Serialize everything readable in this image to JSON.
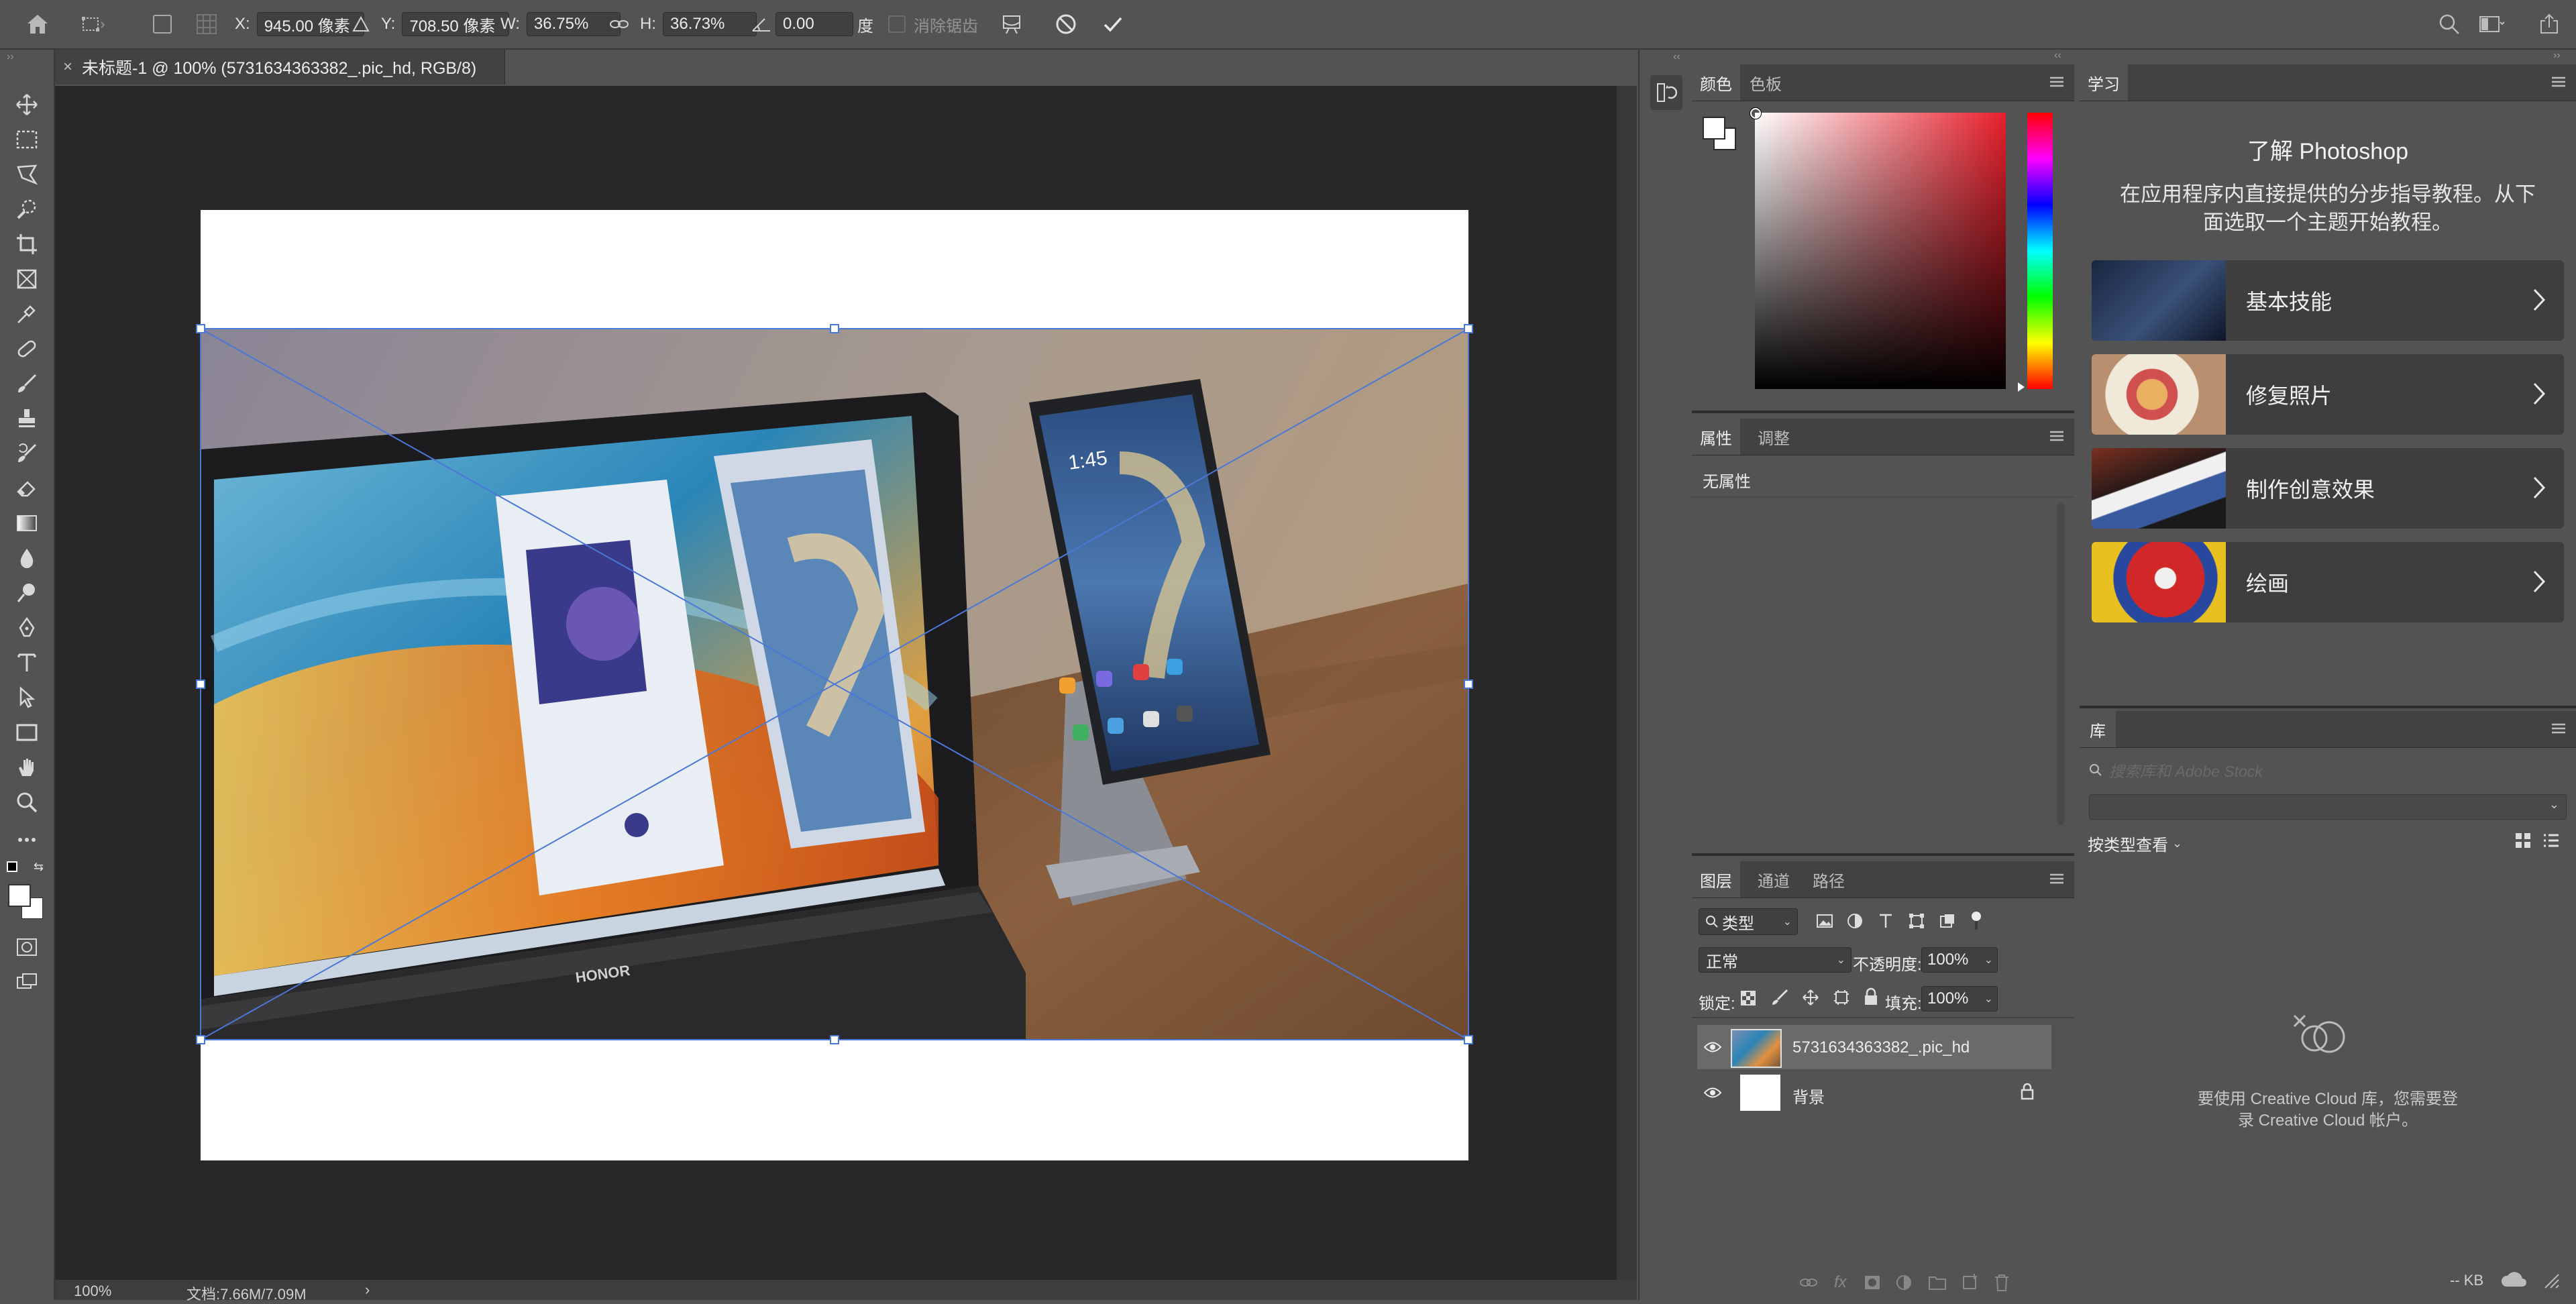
{
  "optionsbar": {
    "x_label": "X:",
    "x_value": "945.00 像素",
    "y_label": "Y:",
    "y_value": "708.50 像素",
    "w_label": "W:",
    "w_value": "36.75%",
    "h_label": "H:",
    "h_value": "36.73%",
    "angle_value": "0.00",
    "angle_unit": "度",
    "antialias_label": "消除锯齿"
  },
  "document": {
    "tab_title": "未标题-1 @ 100% (5731634363382_.pic_hd, RGB/8)",
    "close_glyph": "×"
  },
  "statusbar": {
    "zoom": "100%",
    "doc_info": "文档:7.66M/7.09M",
    "arrow": "›"
  },
  "color_panel": {
    "tabs": [
      "颜色",
      "色板"
    ]
  },
  "properties_panel": {
    "tabs": [
      "属性",
      "调整"
    ],
    "empty_text": "无属性"
  },
  "layers_panel": {
    "tabs": [
      "图层",
      "通道",
      "路径"
    ],
    "filter_kind": "类型",
    "blend_mode": "正常",
    "opacity_label": "不透明度:",
    "opacity_value": "100%",
    "lock_label": "锁定:",
    "fill_label": "填充:",
    "fill_value": "100%",
    "layers": [
      {
        "name": "5731634363382_.pic_hd",
        "selected": true
      },
      {
        "name": "背景",
        "selected": false,
        "locked": true
      }
    ]
  },
  "learn_panel": {
    "tab": "学习",
    "heading": "了解 Photoshop",
    "description_line1": "在应用程序内直接提供的分步指导教程。从下",
    "description_line2": "面选取一个主题开始教程。",
    "topics": [
      {
        "title": "基本技能"
      },
      {
        "title": "修复照片"
      },
      {
        "title": "制作创意效果"
      },
      {
        "title": "绘画"
      }
    ]
  },
  "libraries_panel": {
    "tab": "库",
    "search_placeholder": "搜索库和 Adobe Stock",
    "view_by": "按类型查看",
    "message_line1": "要使用 Creative Cloud 库，您需要登",
    "message_line2": "录 Creative Cloud 帐户。",
    "size": "-- KB"
  },
  "colors": {
    "app_bg": "#535353",
    "canvas_bg": "#282828",
    "panel_header": "#424242",
    "accent_transform": "#4a78d6"
  }
}
